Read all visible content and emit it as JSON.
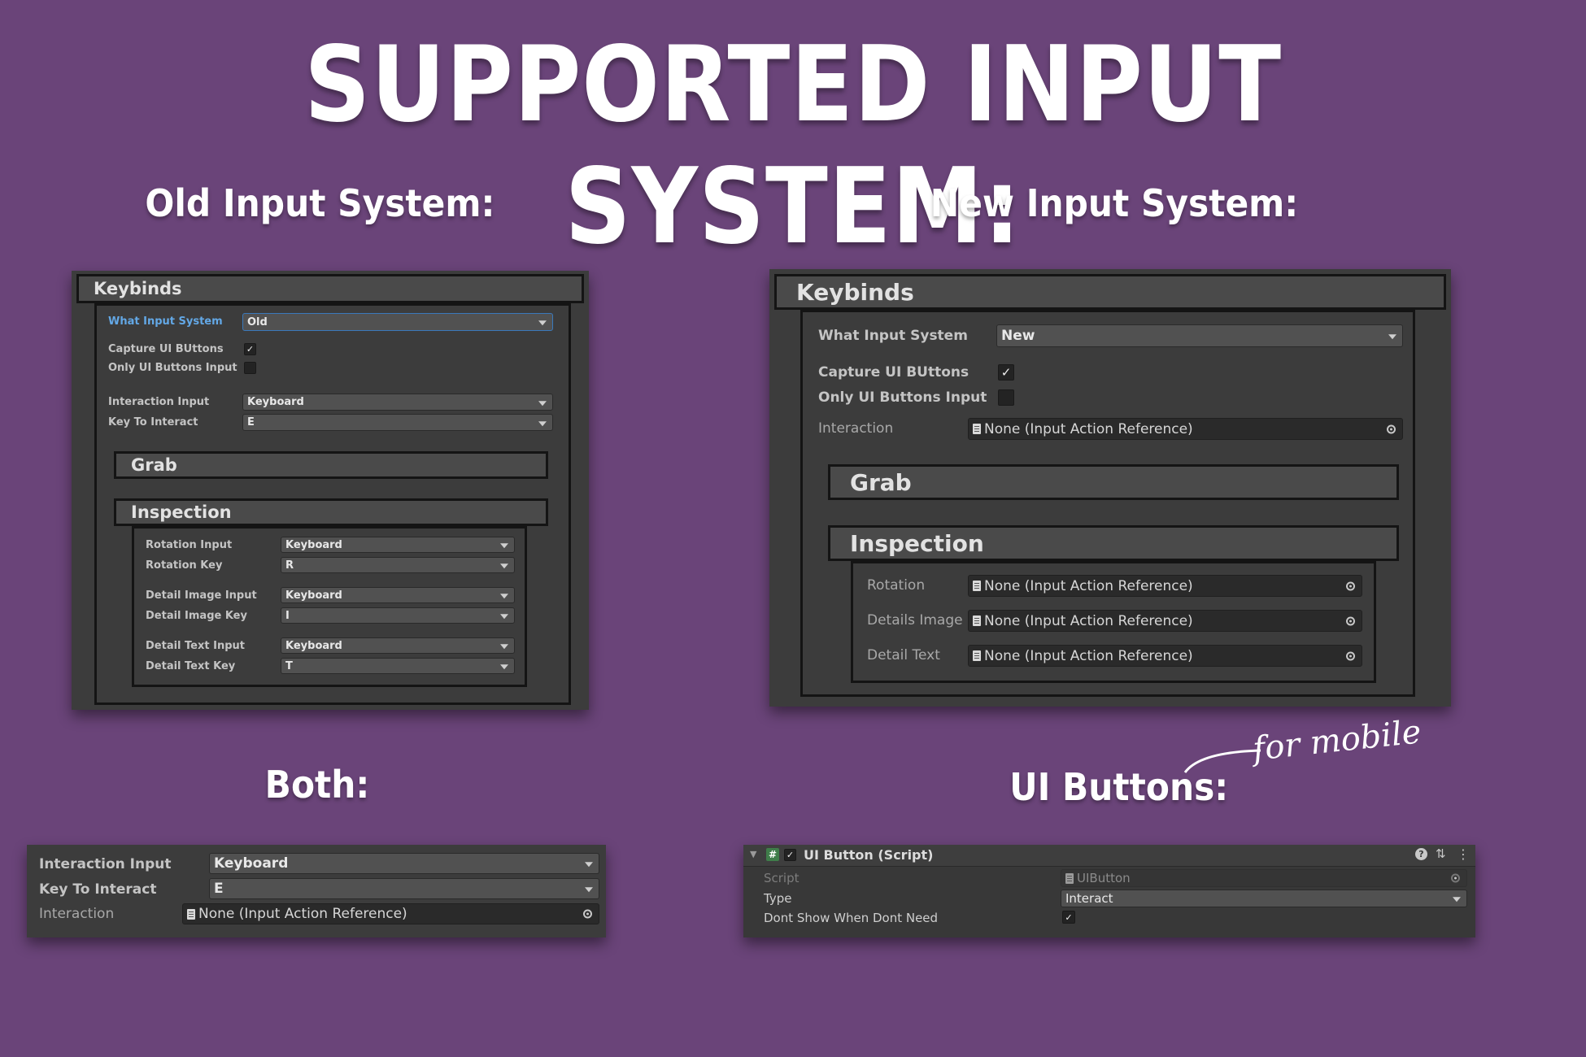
{
  "title": "SUPPORTED INPUT SYSTEM:",
  "sections": {
    "old": "Old Input System:",
    "new": "New Input System:",
    "both": "Both:",
    "ui_buttons": "UI Buttons:",
    "ui_buttons_note": "for mobile"
  },
  "old_panel": {
    "keybinds_header": "Keybinds",
    "what_input_label": "What Input System",
    "what_input_value": "Old",
    "capture_label": "Capture UI BUttons",
    "capture_checked": true,
    "only_ui_label": "Only UI Buttons Input",
    "only_ui_checked": false,
    "interaction_input_label": "Interaction Input",
    "interaction_input_value": "Keyboard",
    "key_to_interact_label": "Key To Interact",
    "key_to_interact_value": "E",
    "grab_header": "Grab",
    "inspection_header": "Inspection",
    "inspection_rows": [
      {
        "label": "Rotation Input",
        "value": "Keyboard"
      },
      {
        "label": "Rotation Key",
        "value": "R"
      },
      {
        "label": "Detail Image Input",
        "value": "Keyboard"
      },
      {
        "label": "Detail Image Key",
        "value": "I"
      },
      {
        "label": "Detail Text Input",
        "value": "Keyboard"
      },
      {
        "label": "Detail Text Key",
        "value": "T"
      }
    ]
  },
  "new_panel": {
    "keybinds_header": "Keybinds",
    "what_input_label": "What Input System",
    "what_input_value": "New",
    "capture_label": "Capture UI BUttons",
    "capture_checked": true,
    "only_ui_label": "Only UI Buttons Input",
    "only_ui_checked": false,
    "interaction_label": "Interaction",
    "interaction_value": "None (Input Action Reference)",
    "grab_header": "Grab",
    "inspection_header": "Inspection",
    "inspection_rows": [
      {
        "label": "Rotation",
        "value": "None (Input Action Reference)"
      },
      {
        "label": "Details Image",
        "value": "None (Input Action Reference)"
      },
      {
        "label": "Detail Text",
        "value": "None (Input Action Reference)"
      }
    ]
  },
  "both_panel": {
    "interaction_input_label": "Interaction Input",
    "interaction_input_value": "Keyboard",
    "key_to_interact_label": "Key To Interact",
    "key_to_interact_value": "E",
    "interaction_label": "Interaction",
    "interaction_value": "None (Input Action Reference)"
  },
  "ui_button_panel": {
    "component_title": "UI Button (Script)",
    "enabled": true,
    "script_label": "Script",
    "script_value": "UIButton",
    "type_label": "Type",
    "type_value": "Interact",
    "dont_show_label": "Dont Show When Dont Need",
    "dont_show_checked": true
  },
  "icons": {
    "check": "✓",
    "help": "?",
    "settings": "⇅",
    "menu": "⋮",
    "fold": "▼",
    "script": "#"
  },
  "colors": {
    "background": "#6a4479",
    "panel": "#3c3c3c",
    "accent": "#63a8e6"
  }
}
